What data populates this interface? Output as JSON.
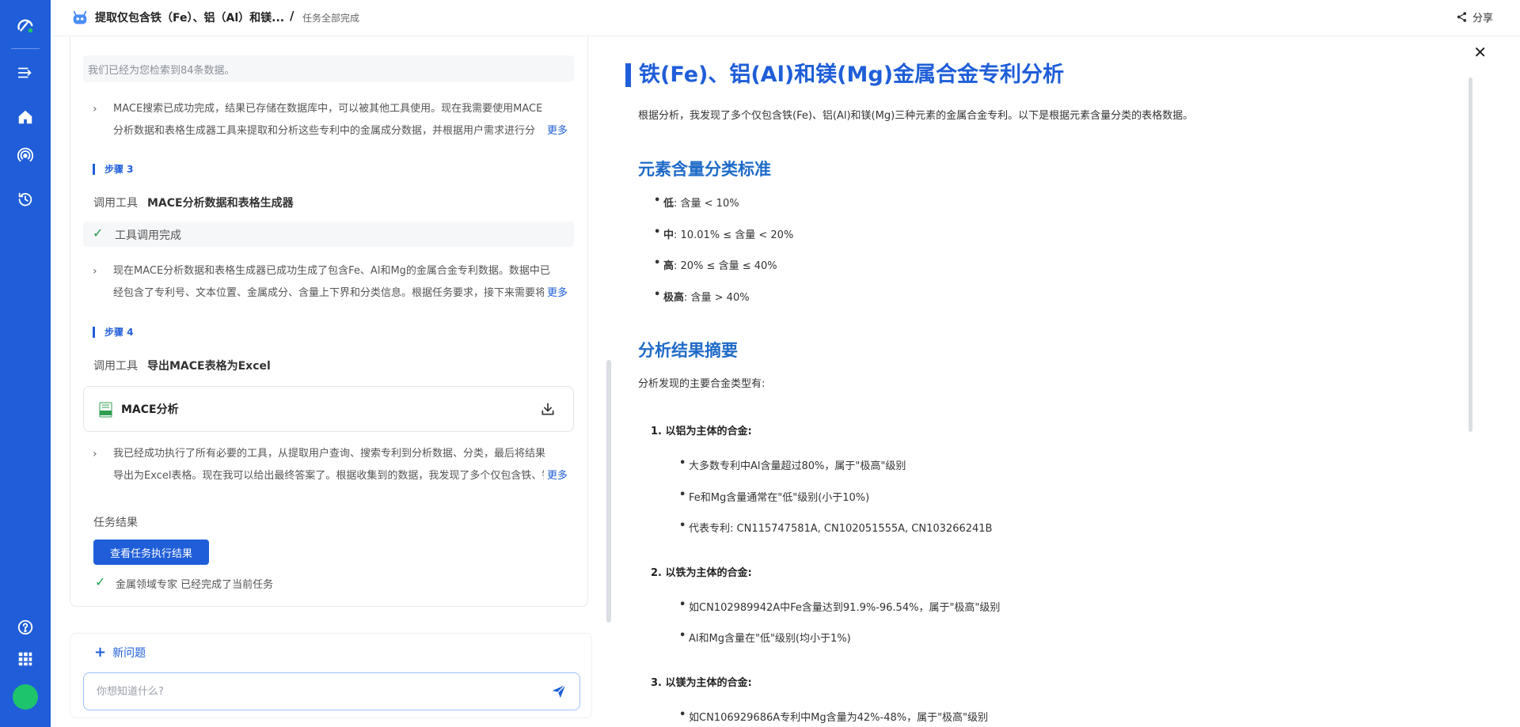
{
  "header": {
    "title": "提取仅包含铁（Fe）、铝（Al）和镁...",
    "status": "任务全部完成",
    "share_label": "分享"
  },
  "chat": {
    "search_info": "我们已经为您检索到84条数据。",
    "thought1": "MACE搜索已成功完成，结果已存储在数据库中，可以被其他工具使用。现在我需要使用MACE分析数据和表格生成器工具来提取和分析这些专利中的金属成分数据，并根据用户需求进行分类。",
    "more_label": "更多",
    "step3_label": "步骤 3",
    "tool_call_label": "调用工具",
    "step3_tool": "MACE分析数据和表格生成器",
    "tool_done": "工具调用完成",
    "thought2": "现在MACE分析数据和表格生成器已成功生成了包含Fe、Al和Mg的金属合金专利数据。数据中已经包含了专利号、文本位置、金属成分、含量上下界和分类信息。根据任务要求，接下来需要将表格导出。",
    "step4_label": "步骤 4",
    "step4_tool": "导出MACE表格为Excel",
    "file_name": "MACE分析",
    "thought3": "我已经成功执行了所有必要的工具，从提取用户查询、搜索专利到分析数据、分类，最后将结果导出为Excel表格。现在我可以给出最终答案了。根据收集到的数据，我发现了多个仅包含铁、铝和镁的金属合金专利。",
    "result_label": "任务结果",
    "result_button": "查看任务执行结果",
    "final_status": "金属领域专家 已经完成了当前任务",
    "new_question": "新问题",
    "input_placeholder": "你想知道什么?"
  },
  "doc": {
    "title": "铁(Fe)、铝(Al)和镁(Mg)金属合金专利分析",
    "intro": "根据分析，我发现了多个仅包含铁(Fe)、铝(Al)和镁(Mg)三种元素的金属合金专利。以下是根据元素含量分类的表格数据。",
    "h2_criteria": "元素含量分类标准",
    "criteria": [
      {
        "level": "低",
        "rule": ": 含量 < 10%"
      },
      {
        "level": "中",
        "rule": ": 10.01% ≤ 含量 < 20%"
      },
      {
        "level": "高",
        "rule": ": 20% ≤ 含量 ≤ 40%"
      },
      {
        "level": "极高",
        "rule": ": 含量 > 40%"
      }
    ],
    "h2_summary": "分析结果摘要",
    "summary_intro": "分析发现的主要合金类型有:",
    "groups": [
      {
        "title": "1. 以铝为主体的合金:",
        "items": [
          "大多数专利中Al含量超过80%，属于\"极高\"级别",
          "Fe和Mg含量通常在\"低\"级别(小于10%)",
          "代表专利: CN115747581A, CN102051555A, CN103266241B"
        ]
      },
      {
        "title": "2. 以铁为主体的合金:",
        "items": [
          "如CN102989942A中Fe含量达到91.9%-96.54%，属于\"极高\"级别",
          "Al和Mg含量在\"低\"级别(均小于1%)"
        ]
      },
      {
        "title": "3. 以镁为主体的合金:",
        "items": [
          "如CN106929686A专利中Mg含量为42%-48%，属于\"极高\"级别"
        ]
      }
    ]
  },
  "colors": {
    "brand": "#1f5ed8",
    "success": "#1aa34a",
    "avatar": "#1ec46b"
  }
}
